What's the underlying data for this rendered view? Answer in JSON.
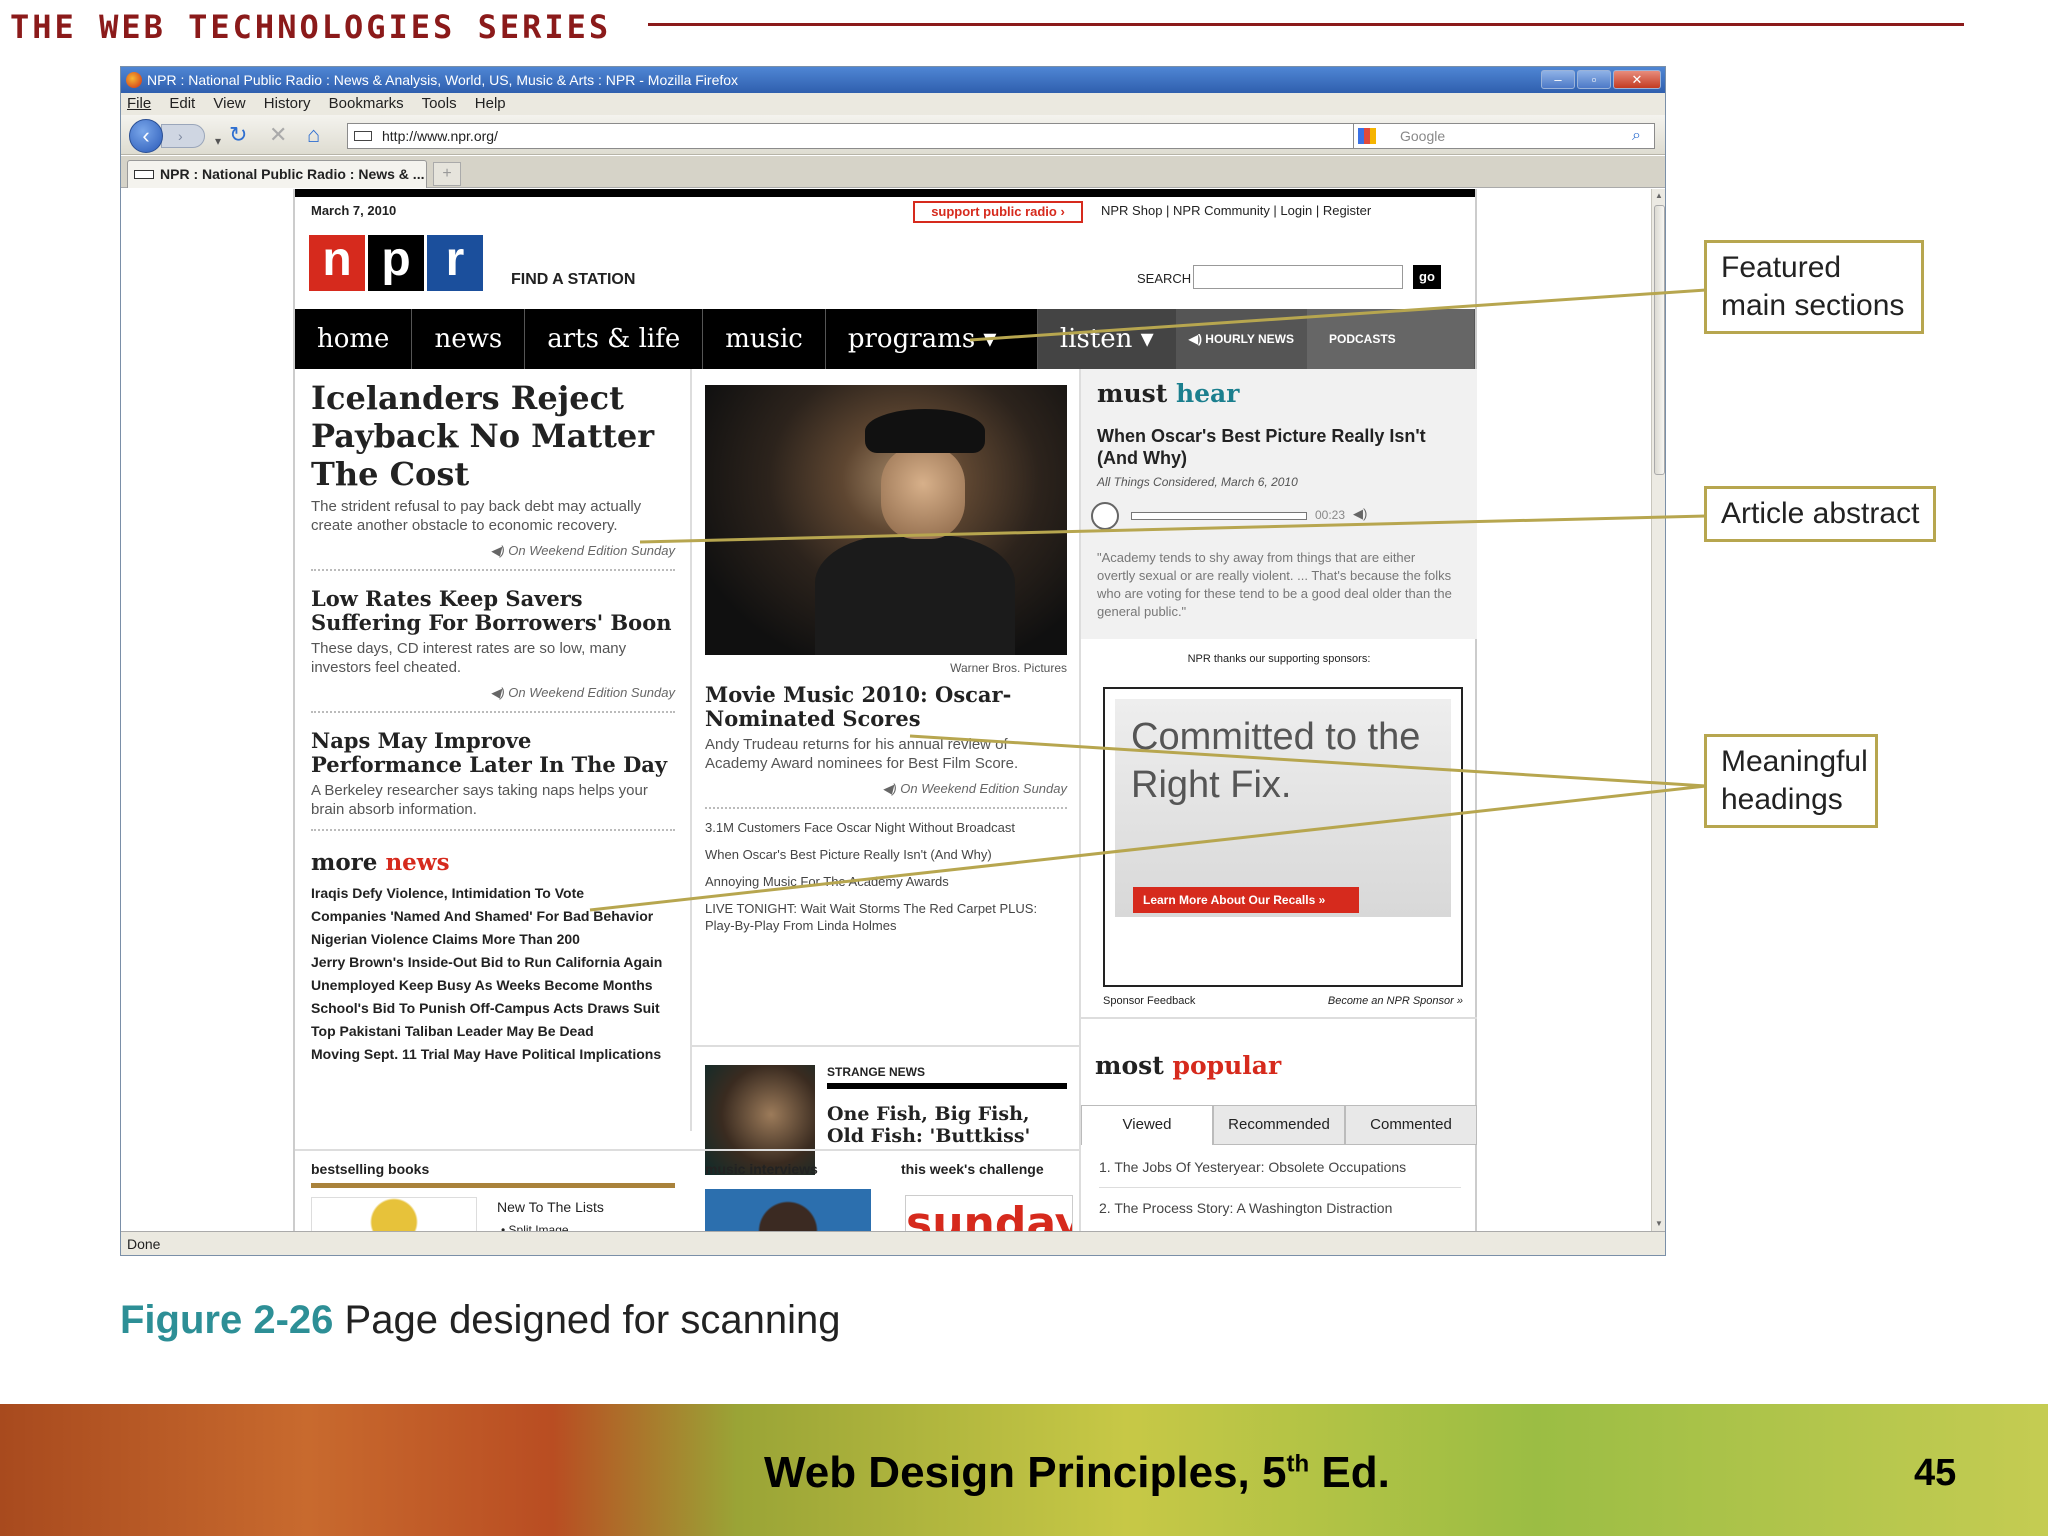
{
  "slide": {
    "series_title": "THE WEB TECHNOLOGIES SERIES",
    "caption_number": "Figure 2-26",
    "caption_text": "Page designed for scanning",
    "footer_title": "Web Design Principles, 5",
    "footer_title_sup": "th",
    "footer_title_end": " Ed.",
    "page_number": "45",
    "callouts": {
      "featured": "Featured main sections",
      "abstract": "Article abstract",
      "headings": "Meaningful headings"
    }
  },
  "browser": {
    "window_title": "NPR : National Public Radio : News & Analysis, World, US, Music & Arts : NPR - Mozilla Firefox",
    "menu": [
      "File",
      "Edit",
      "View",
      "History",
      "Bookmarks",
      "Tools",
      "Help"
    ],
    "url": "http://www.npr.org/",
    "search_placeholder": "Google",
    "tab_title": "NPR : National Public Radio : News & ...",
    "status": "Done"
  },
  "npr": {
    "date": "March 7, 2010",
    "support": "support public radio ›",
    "top_links": "NPR Shop  |  NPR Community  |  Login  |  Register",
    "logo": [
      "n",
      "p",
      "r"
    ],
    "find_station": "FIND A STATION",
    "search_label": "SEARCH",
    "go": "go",
    "nav": [
      "home",
      "news",
      "arts & life",
      "music",
      "programs ▾",
      "listen ▾",
      "◀) HOURLY NEWS",
      "PODCASTS"
    ],
    "story1": {
      "headline": "Icelanders Reject Payback No Matter The Cost",
      "abstract": "The strident refusal to pay back debt may actually create another obstacle to economic recovery.",
      "meta": "◀) On Weekend Edition Sunday"
    },
    "story2": {
      "headline": "Low Rates Keep Savers Suffering For Borrowers' Boon",
      "abstract": "These days, CD interest rates are so low, many investors feel cheated.",
      "meta": "◀) On Weekend Edition Sunday"
    },
    "story3": {
      "headline": "Naps May Improve Performance Later In The Day",
      "abstract": "A Berkeley researcher says taking naps helps your brain absorb information."
    },
    "more_news_a": "more ",
    "more_news_b": "news",
    "more_news": [
      "Iraqis Defy Violence, Intimidation To Vote",
      "Companies 'Named And Shamed' For Bad Behavior",
      "Nigerian Violence Claims More Than 200",
      "Jerry Brown's Inside-Out Bid to Run California Again",
      "Unemployed Keep Busy As Weeks Become Months",
      "School's Bid To Punish Off-Campus Acts Draws Suit",
      "Top Pakistani Taliban Leader May Be Dead",
      "Moving Sept. 11 Trial May Have Political Implications"
    ],
    "photo_credit": "Warner Bros. Pictures",
    "feature": {
      "headline": "Movie Music 2010: Oscar-Nominated Scores",
      "abstract": "Andy Trudeau returns for his annual review of Academy Award nominees for Best Film Score.",
      "meta": "◀) On Weekend Edition Sunday",
      "bullets": [
        "3.1M Customers Face Oscar Night Without Broadcast",
        "When Oscar's Best Picture Really Isn't (And Why)",
        "Annoying Music For The Academy Awards",
        "LIVE TONIGHT: Wait Wait Storms The Red Carpet PLUS: Play-By-Play From Linda Holmes"
      ]
    },
    "strange_news": "STRANGE NEWS",
    "fish_headline": "One Fish, Big Fish, Old Fish: 'Buttkiss'",
    "must_a": "must ",
    "must_b": "hear",
    "must_headline": "When Oscar's Best Picture Really Isn't (And Why)",
    "must_meta": "All Things Considered, March 6, 2010",
    "must_time": "00:23",
    "must_quote": "\"Academy tends to shy away from things that are either overtly sexual or are really violent. ... That's because the folks who are voting for these tend to be a good deal older than the general public.\"",
    "sponsor_thanks": "NPR thanks our supporting sponsors:",
    "ad_text": "Committed to the Right Fix.",
    "ad_button": "Learn More About Our Recalls »",
    "sponsor_feedback": "Sponsor Feedback",
    "become_sponsor": "Become an NPR Sponsor »",
    "pop_a": "most ",
    "pop_b": "popular",
    "pop_tabs": [
      "Viewed",
      "Recommended",
      "Commented"
    ],
    "pop_items": [
      "1. The Jobs Of Yesteryear: Obsolete Occupations",
      "2. The Process Story: A Washington Distraction"
    ],
    "books": "bestselling books",
    "books_sub": "New To The Lists",
    "books_item": "• Split Image",
    "music_interviews": "music interviews",
    "challenge": "this week's challenge",
    "sunday": "sunday"
  },
  "colors": {
    "npr_red": "#d62a1d",
    "npr_black": "#000000",
    "npr_blue": "#1b4f9c",
    "callout_border": "#b7a64f",
    "series_red": "#8b1a1a",
    "caption_teal": "#2d8f96"
  }
}
